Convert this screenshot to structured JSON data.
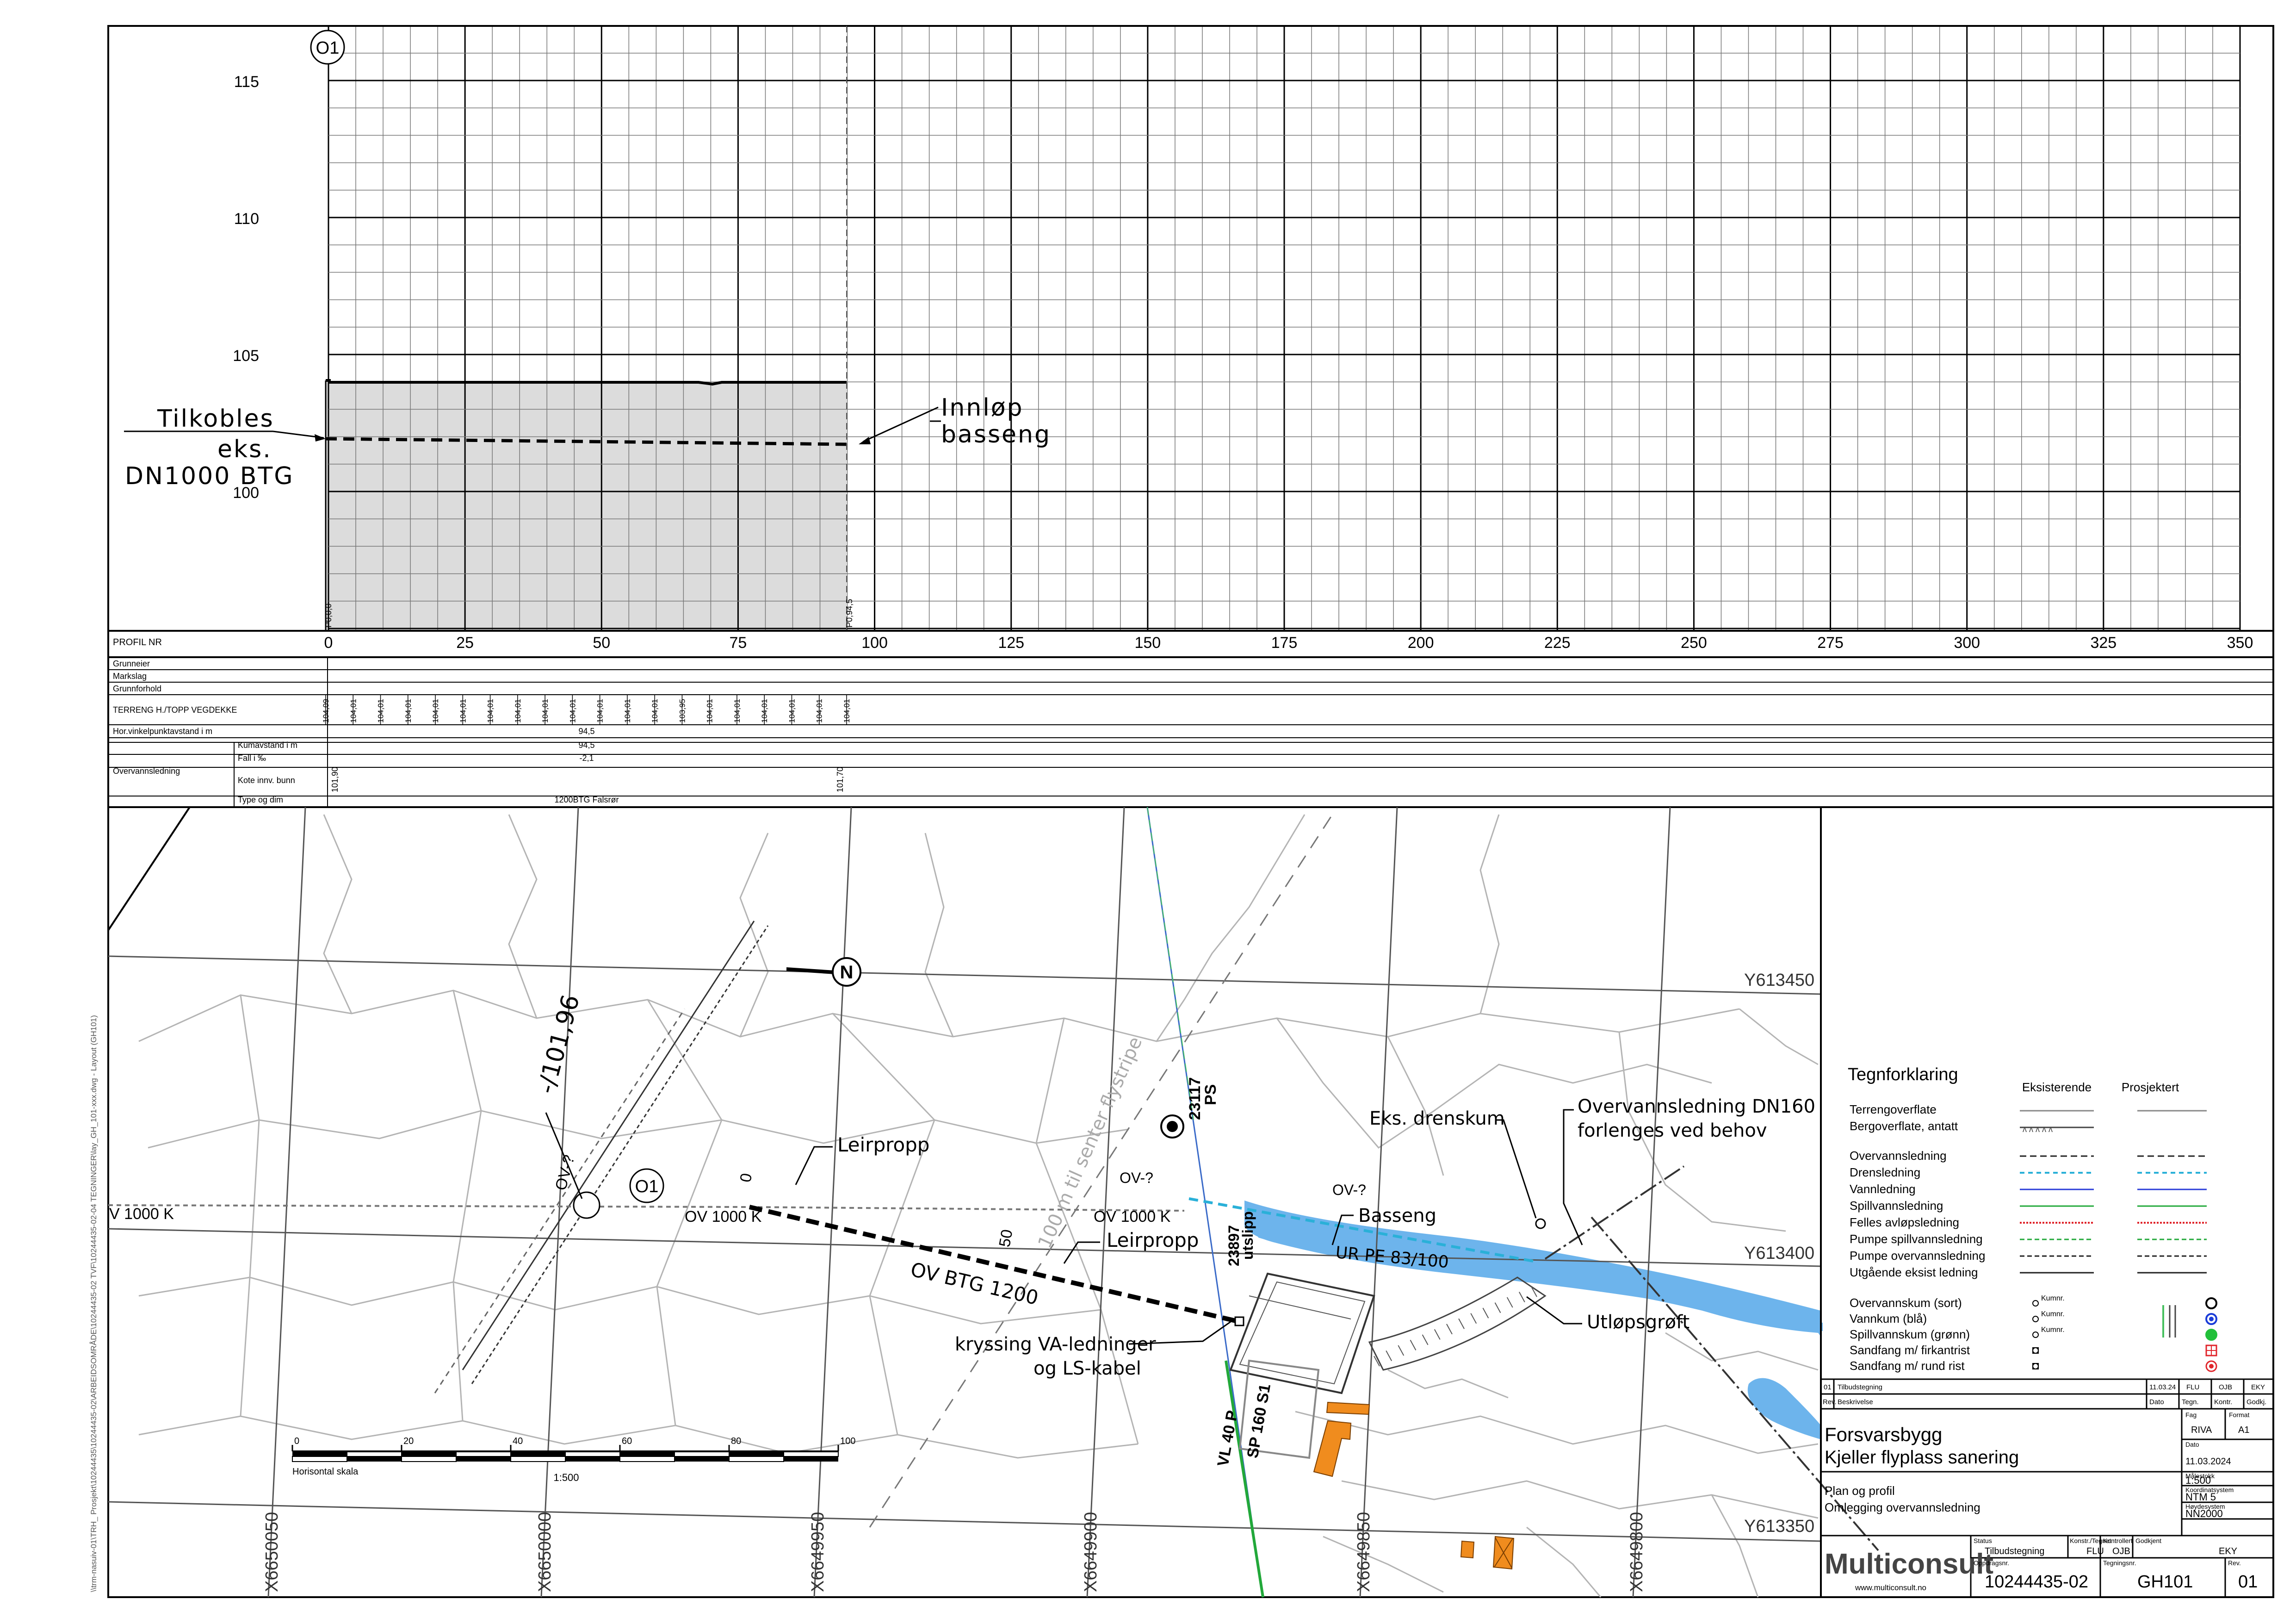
{
  "profile": {
    "section_label": "O1",
    "y_ticks": [
      "115",
      "110",
      "105",
      "100"
    ],
    "x_ticks": [
      "0",
      "25",
      "50",
      "75",
      "100",
      "125",
      "150",
      "175",
      "200",
      "225",
      "250",
      "275",
      "300",
      "325",
      "350"
    ],
    "station_start": "P0,0,0",
    "station_end": "P0,94,5",
    "annot_left": [
      "Tilkobles",
      "eks.",
      "DN1000 BTG"
    ],
    "annot_right": [
      "Innløp",
      "basseng"
    ]
  },
  "band": {
    "profil_nr": "PROFIL NR",
    "grunneier": "Grunneier",
    "markslag": "Markslag",
    "grunnforhold": "Grunnforhold",
    "terreng_label": "TERRENG H./TOPP VEGDEKKE",
    "terreng_values": [
      "104,09",
      "104,01",
      "104,01",
      "104,01",
      "104,01",
      "104,01",
      "104,01",
      "104,01",
      "104,01",
      "104,01",
      "104,01",
      "104,01",
      "104,01",
      "103,95",
      "104,01",
      "104,01",
      "104,01",
      "104,01",
      "104,01",
      "104,01"
    ],
    "hor_label": "Hor.vinkelpunktavstand i m",
    "hor_value": "94,5",
    "group_label": "Overvannsledning",
    "kum_label": "Kumavstand i m",
    "kum_value": "94,5",
    "fall_label": "Fall i ‰",
    "fall_value": "-2,1",
    "kote_label": "Kote innv. bunn",
    "kote_start": "101,90",
    "kote_end": "101,70",
    "type_label": "Type og dim",
    "type_value": "1200BTG Falsrør"
  },
  "plan": {
    "grid_labels": [
      "Y613450",
      "Y613400",
      "Y613350",
      "X6650050",
      "X6650000",
      "X6649950",
      "X6649900",
      "X6649850",
      "X6649800"
    ],
    "north": "N",
    "labels": {
      "section": "O1",
      "ov1000_left": "V 1000 K",
      "ov1000_mid": "OV 1000 K",
      "ov1000_right": "OV 1000 K",
      "ov_btg": "OV BTG 1200",
      "leirpropp1": "Leirpropp",
      "leirpropp2": "Leirpropp",
      "chain0": "0",
      "chain50": "50",
      "level": "-/101,96",
      "ov_q1": "OV-?",
      "ov_q2": "OV-?",
      "ov_q3": "OV-?",
      "ps_num": "23117",
      "ps": "PS",
      "utslipp_num": "23897",
      "utslipp": "utslipp",
      "centerline": "100 m til senter flystripe",
      "basseng": "Basseng",
      "ur_pe": "UR PE 83/100",
      "eks_drenskum": "Eks. drenskum",
      "ovl_dn160_1": "Overvannsledning DN160",
      "ovl_dn160_2": "forlenges ved behov",
      "utlopsgroft": "Utløpsgrøft",
      "kryssing1": "kryssing VA-ledninger",
      "kryssing2": "og LS-kabel",
      "vl": "VL 40 P",
      "sp": "SP 160 S1"
    },
    "scale_ticks": [
      "0",
      "20",
      "40",
      "60",
      "80",
      "100"
    ],
    "scale_caption": "Horisontal skala",
    "scale_ratio": "1:500",
    "side_path": "\\\\trm-nasuiv-01\\TRH_ Prosjekt\\10244435\\10244435-02\\ARBEIDSOMRÅDE\\10244435-02 TVF\\10244435-02-04 TEGNINGER\\lay_GH_101-xxx.dwg - Layout (GH101)"
  },
  "legend": {
    "title": "Tegnforklaring",
    "col_existing": "Eksisterende",
    "col_project": "Prosjektert",
    "terrain": "Terrengoverflate",
    "bedrock": "Bergoverflate, antatt",
    "rows": [
      {
        "label": "Overvannsledning",
        "color": "#222222",
        "dash": "14 8",
        "width": 3
      },
      {
        "label": "Drensledning",
        "color": "#2ab0d8",
        "dash": "10 8",
        "width": 4
      },
      {
        "label": "Vannledning",
        "color": "#2a3cd8",
        "dash": "",
        "width": 3
      },
      {
        "label": "Spillvannsledning",
        "color": "#22a83a",
        "dash": "",
        "width": 3
      },
      {
        "label": "Felles avløpsledning",
        "color": "#e0252b",
        "dash": "4 3",
        "width": 4
      },
      {
        "label": "Pumpe spillvannsledning",
        "color": "#22a83a",
        "dash": "10 6",
        "width": 3
      },
      {
        "label": "Pumpe overvannsledning",
        "color": "#222222",
        "dash": "10 6",
        "width": 3
      },
      {
        "label": "Utgående eksist ledning",
        "color": "#222222",
        "dash": "",
        "width": 3
      }
    ],
    "kum_rows": [
      {
        "label": "Overvannskum (sort)",
        "color": "#000000"
      },
      {
        "label": "Vannkum (blå)",
        "color": "#1a3cd8"
      },
      {
        "label": "Spillvannskum (grønn)",
        "color": "#22c03a"
      },
      {
        "label": "Sandfang m/ firkantrist",
        "color": "#e0252b"
      },
      {
        "label": "Sandfang m/ rund rist",
        "color": "#e0252b"
      }
    ],
    "kumnr": "Kumnr."
  },
  "titleblock": {
    "rev_row": [
      "01",
      "Tilbudstegning",
      "11.03.24",
      "FLU",
      "OJB",
      "EKY"
    ],
    "rev_header": [
      "Rev.",
      "Beskrivelse",
      "Dato",
      "Tegn.",
      "Kontr.",
      "Godkj."
    ],
    "client": "Forsvarsbygg",
    "project": "Kjeller flyplass sanering",
    "fag_label": "Fag",
    "fag": "RIVA",
    "format_label": "Format",
    "format": "A1",
    "dato_label": "Dato",
    "dato": "11.03.2024",
    "drawing_title_1": "Plan og profil",
    "drawing_title_2": "Omlegging overvannsledning",
    "scale_label": "Målestokk",
    "scale": "1:500",
    "coord_label": "Koordinatsystem",
    "coord": "NTM 5",
    "height_label": "Høydesystem",
    "height": "NN2000",
    "company": "Multiconsult",
    "website": "www.multiconsult.no",
    "status_label": "Status",
    "status": "Tilbudstegning",
    "konstr_label": "Konstr./Tegnet",
    "konstr": "FLU",
    "kontrollert_label": "Kontrollert",
    "kontrollert": "OJB",
    "godkjent_label": "Godkjent",
    "godkjent": "EKY",
    "oppdrag_label": "Oppdragsnr.",
    "oppdrag": "10244435-02",
    "tegningnr_label": "Tegningsnr.",
    "tegningnr": "GH101",
    "rev_label": "Rev.",
    "rev": "01"
  }
}
